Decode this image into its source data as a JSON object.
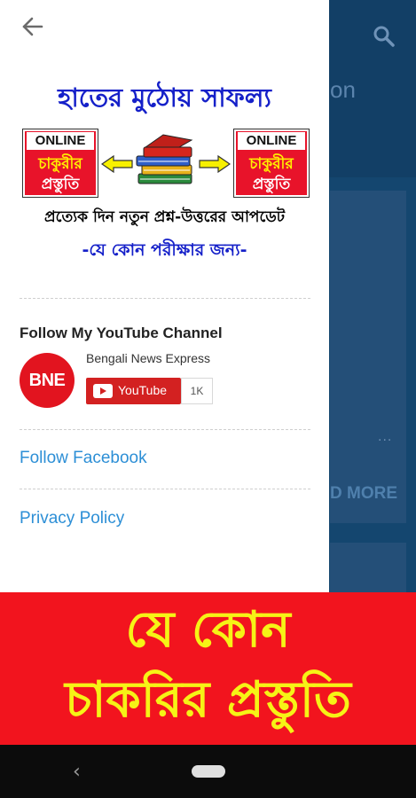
{
  "background": {
    "title_fragment": "on",
    "read_more": "D MORE",
    "dots": "..."
  },
  "drawer": {
    "banner": {
      "title": "হাতের মুঠোয় সাফল্য",
      "badge_online": "ONLINE",
      "badge_line1": "চাকুরীর",
      "badge_line2": "প্রস্তুতি",
      "line1": "প্রত্যেক দিন নতুন প্রশ্ন-উত্তরের আপডেট",
      "line2": "-যে কোন পরীক্ষার জন্য-"
    },
    "follow_title": "Follow My YouTube Channel",
    "channel": {
      "logo_text": "BNE",
      "name": "Bengali News Express",
      "youtube_label": "YouTube",
      "subscriber_count": "1K"
    },
    "links": {
      "facebook": "Follow Facebook",
      "privacy": "Privacy Policy"
    }
  },
  "promo": {
    "line1": "যে কোন",
    "line2": "চাকরির প্রস্তুতি"
  },
  "colors": {
    "banner_blue": "#1520c9",
    "badge_red": "#e8132a",
    "link_blue": "#2d8fd6",
    "promo_red": "#f2141e",
    "promo_yellow": "#f6f316",
    "youtube_red": "#d32121",
    "app_bg": "#14466f"
  }
}
